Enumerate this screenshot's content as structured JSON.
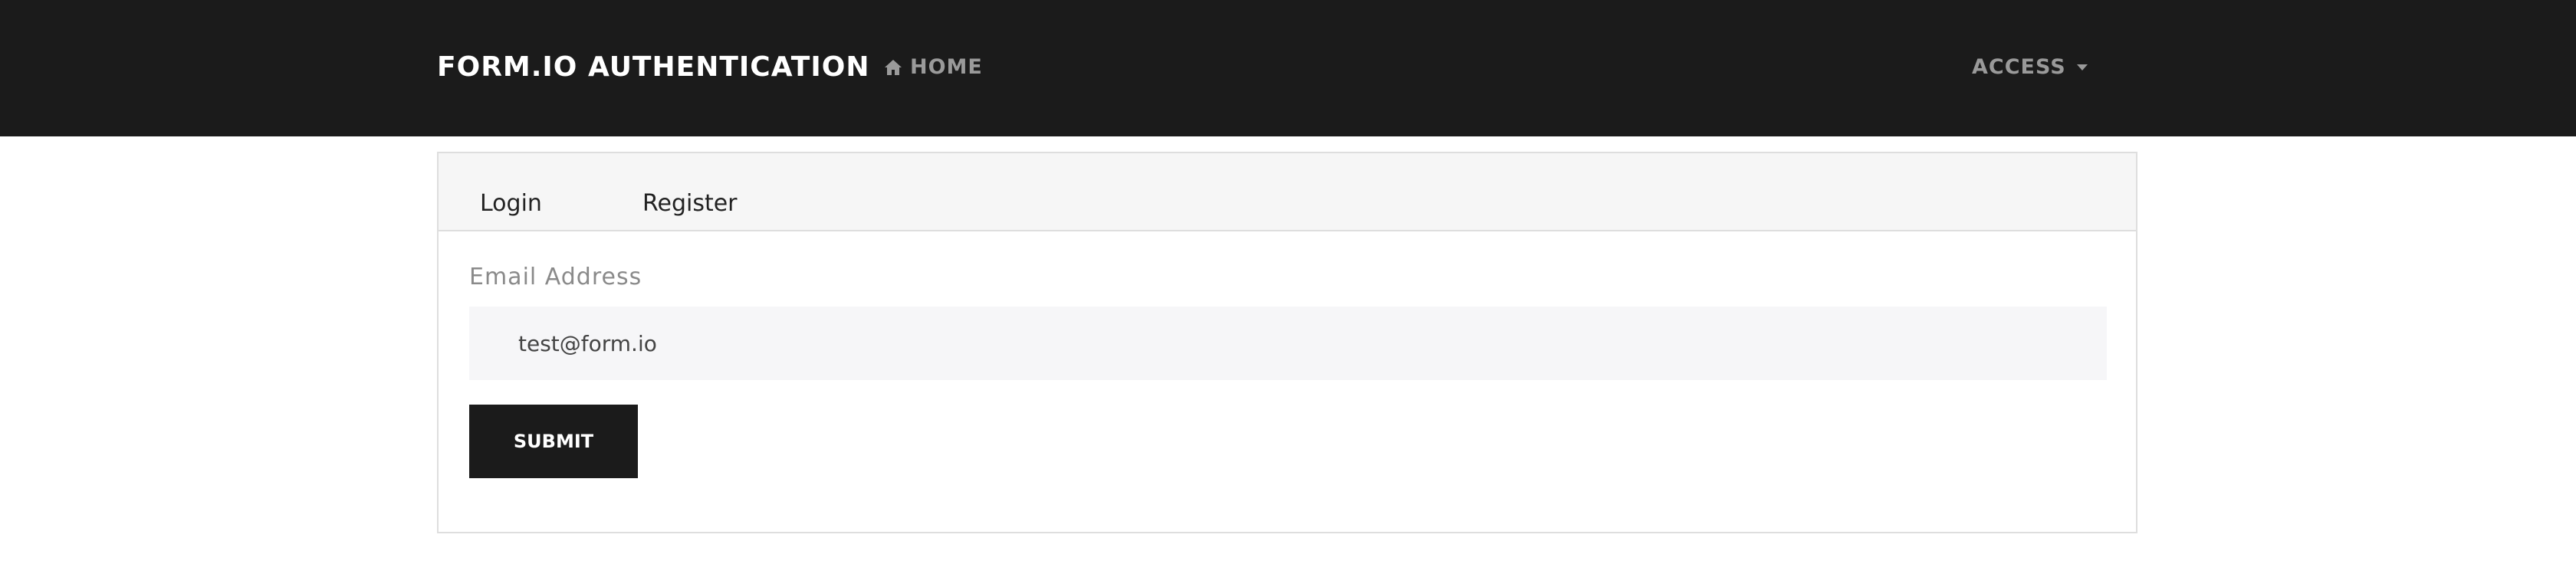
{
  "navbar": {
    "brand": "FORM.IO AUTHENTICATION",
    "home_label": "HOME",
    "home_icon": "home-icon",
    "access_label": "ACCESS",
    "access_icon": "caret-down-icon",
    "background_color": "#1b1b1b",
    "link_color": "#9a9a9a"
  },
  "form": {
    "tabs": [
      {
        "label": "Login"
      },
      {
        "label": "Register"
      }
    ],
    "email": {
      "label": "Email Address",
      "value": "test@form.io"
    },
    "submit_label": "SUBMIT",
    "submit_color": "#1b1b1b"
  }
}
